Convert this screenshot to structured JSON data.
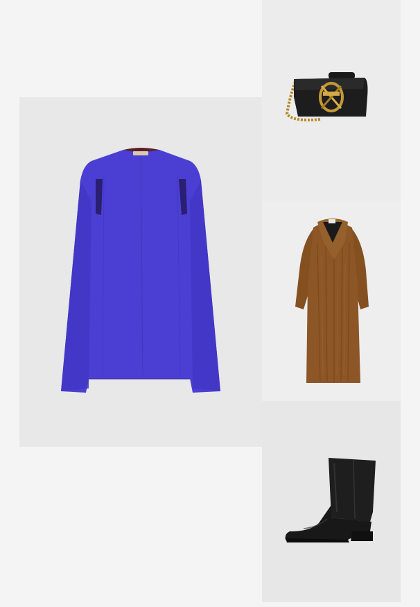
{
  "collage": {
    "items": [
      {
        "id": "cape-dress",
        "icon": "cape-dress-product-photo",
        "color": "#4a3fd6"
      },
      {
        "id": "chain-bag",
        "icon": "black-chain-bag-product-photo",
        "color": "#1c1c1c"
      },
      {
        "id": "fur-coat",
        "icon": "brown-faux-fur-coat-product-photo",
        "color": "#8a5424"
      },
      {
        "id": "ankle-boot",
        "icon": "black-leather-ankle-boot-product-photo",
        "color": "#151515"
      }
    ]
  }
}
